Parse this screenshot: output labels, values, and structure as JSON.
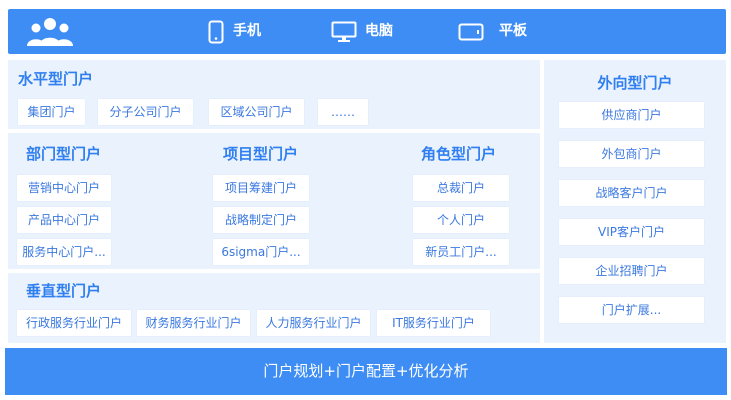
{
  "header": {
    "devices": [
      {
        "label": "手机",
        "icon": "phone-icon"
      },
      {
        "label": "电脑",
        "icon": "monitor-icon"
      },
      {
        "label": "平板",
        "icon": "tablet-icon"
      }
    ],
    "logo_icon": "users-group-icon"
  },
  "horizontal": {
    "title": "水平型门户",
    "items": [
      "集团门户",
      "分子公司门户",
      "区域公司门户",
      "……"
    ]
  },
  "department": {
    "title": "部门型门户",
    "items": [
      "营销中心门户",
      "产品中心门户",
      "服务中心门户..."
    ]
  },
  "project": {
    "title": "项目型门户",
    "items": [
      "项目筹建门户",
      "战略制定门户",
      "6sigma门户..."
    ]
  },
  "role": {
    "title": "角色型门户",
    "items": [
      "总裁门户",
      "个人门户",
      "新员工门户..."
    ]
  },
  "vertical": {
    "title": "垂直型门户",
    "items": [
      "行政服务行业门户",
      "财务服务行业门户",
      "人力服务行业门户",
      "IT服务行业门户"
    ]
  },
  "external": {
    "title": "外向型门户",
    "items": [
      "供应商门户",
      "外包商门户",
      "战略客户门户",
      "VIP客户门户",
      "企业招聘门户",
      "门户扩展..."
    ]
  },
  "footer": {
    "label": "门户规划+门户配置+优化分析"
  },
  "colors": {
    "accent": "#3d8df5",
    "panel": "#eaf2fd",
    "title_text": "#2f7ff0",
    "chip_text": "#3a78e0"
  }
}
